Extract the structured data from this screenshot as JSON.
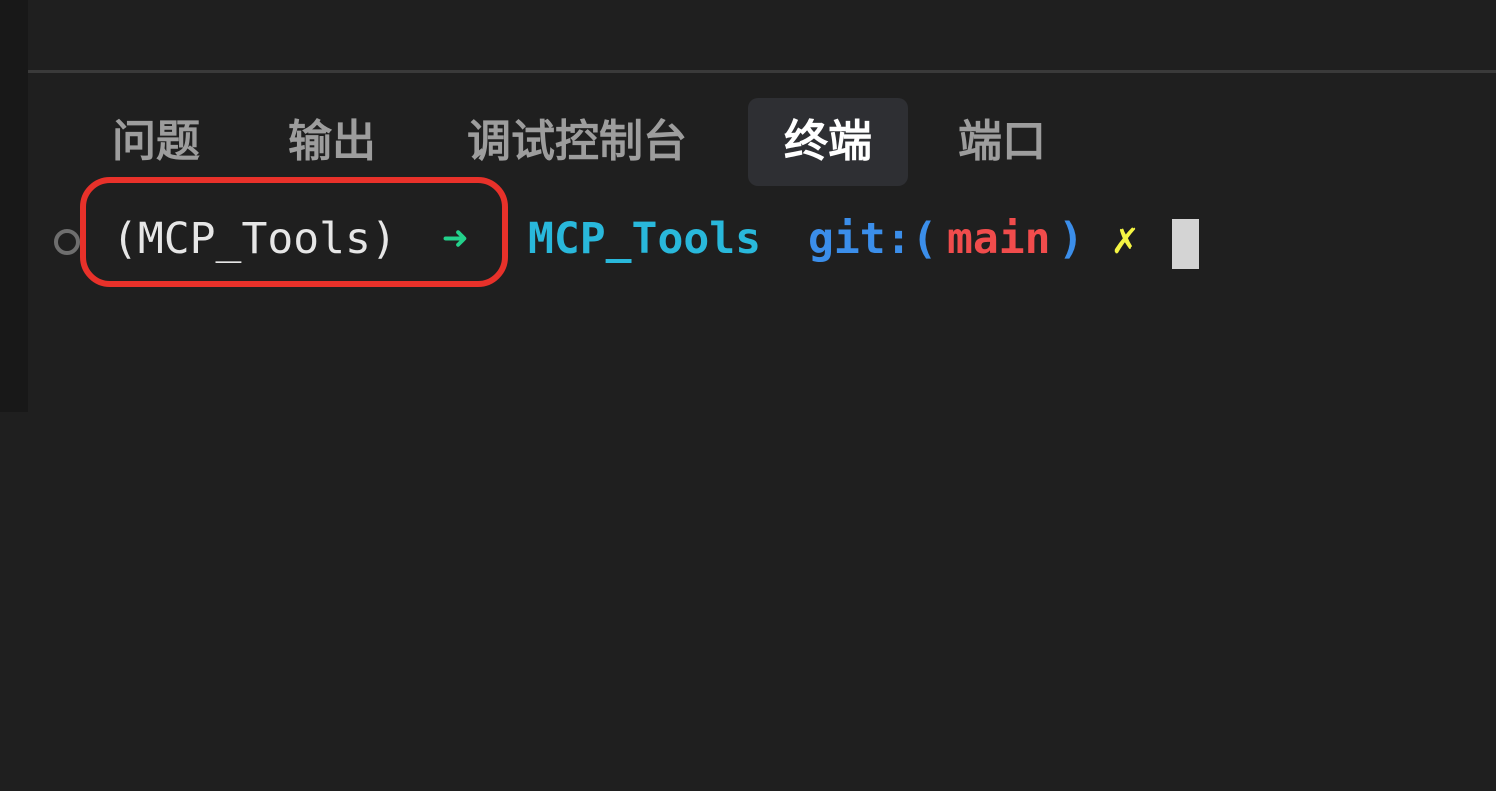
{
  "panel": {
    "tabs": [
      {
        "label": "问题",
        "active": false
      },
      {
        "label": "输出",
        "active": false
      },
      {
        "label": "调试控制台",
        "active": false
      },
      {
        "label": "终端",
        "active": true
      },
      {
        "label": "端口",
        "active": false
      }
    ]
  },
  "terminal": {
    "prompt": {
      "env": "(MCP_Tools)",
      "arrow": "➜",
      "directory": "MCP_Tools",
      "git_prefix": "git:(",
      "branch": "main",
      "git_suffix": ")",
      "dirty_mark": "✗"
    }
  },
  "colors": {
    "background": "#1f1f1f",
    "tab_active_bg": "#2e2f33",
    "env_text": "#e6e6e6",
    "arrow": "#23d18b",
    "directory": "#29b8db",
    "git": "#3b8eea",
    "branch": "#f14c4c",
    "dirty_mark": "#f5f543",
    "highlight_box": "#e8312a"
  }
}
